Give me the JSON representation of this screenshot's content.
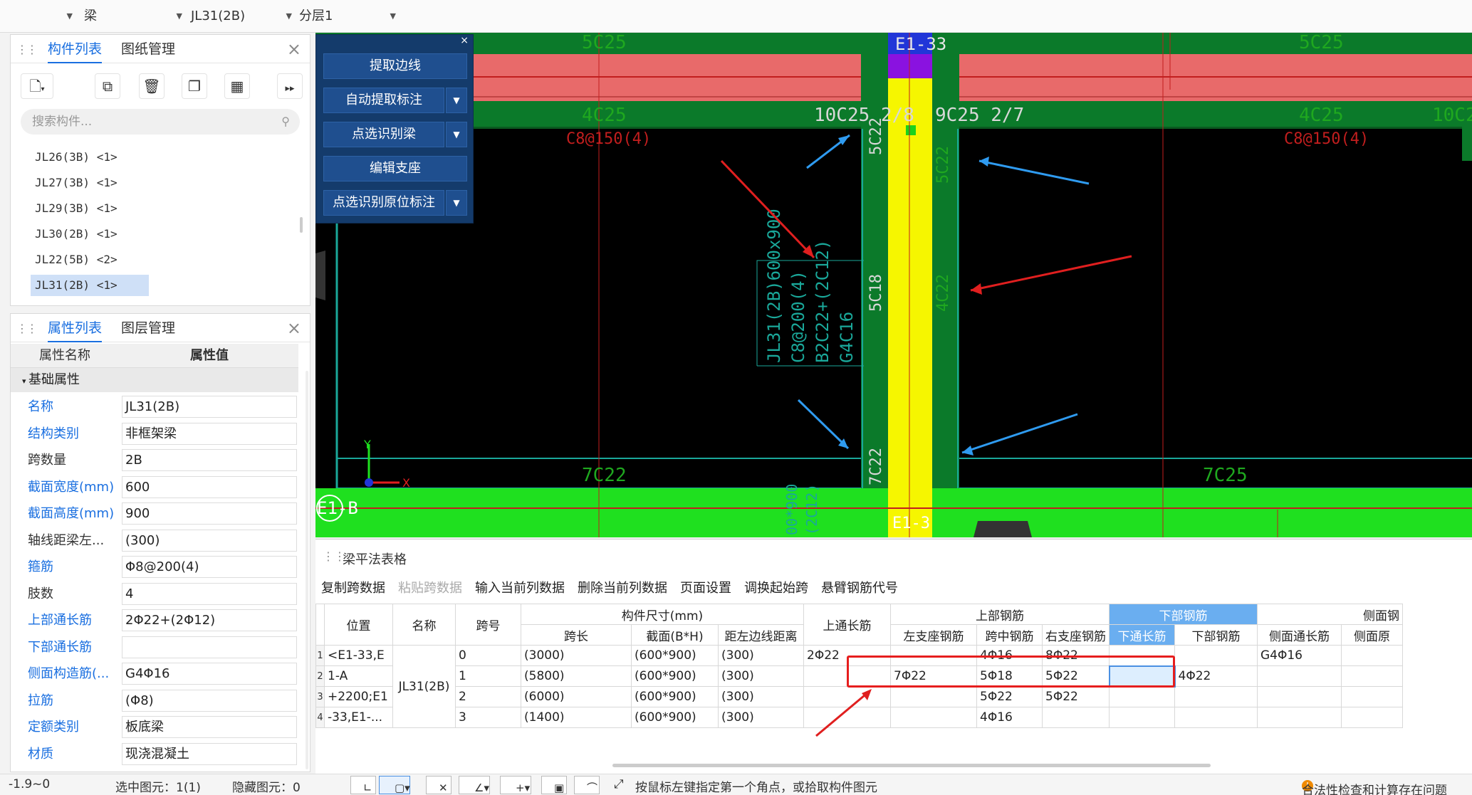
{
  "topbar": {
    "selectors": [
      "",
      "梁",
      "JL31(2B)",
      "分层1"
    ]
  },
  "component_panel": {
    "tabs": [
      "构件列表",
      "图纸管理"
    ],
    "search_placeholder": "搜索构件...",
    "items": [
      "JL26(3B) <1>",
      "JL27(3B) <1>",
      "JL29(3B) <1>",
      "JL30(2B) <1>",
      "JL22(5B) <2>",
      "JL31(2B) <1>"
    ],
    "selected_index": 5
  },
  "property_panel": {
    "tabs": [
      "属性列表",
      "图层管理"
    ],
    "header_name": "属性名称",
    "header_value": "属性值",
    "section": "基础属性",
    "rows": [
      {
        "name": "名称",
        "value": "JL31(2B)"
      },
      {
        "name": "结构类别",
        "value": "非框架梁"
      },
      {
        "name": "跨数量",
        "value": "2B"
      },
      {
        "name": "截面宽度(mm)",
        "value": "600"
      },
      {
        "name": "截面高度(mm)",
        "value": "900"
      },
      {
        "name": "轴线距梁左...",
        "value": "(300)"
      },
      {
        "name": "箍筋",
        "value": "Φ8@200(4)"
      },
      {
        "name": "肢数",
        "value": "4"
      },
      {
        "name": "上部通长筋",
        "value": "2Φ22+(2Φ12)"
      },
      {
        "name": "下部通长筋",
        "value": ""
      },
      {
        "name": "侧面构造筋(...",
        "value": "G4Φ16"
      },
      {
        "name": "拉筋",
        "value": "(Φ8)"
      },
      {
        "name": "定额类别",
        "value": "板底梁"
      },
      {
        "name": "材质",
        "value": "现浇混凝土"
      }
    ]
  },
  "palette": {
    "buttons": [
      "提取边线",
      "自动提取标注",
      "点选识别梁",
      "编辑支座",
      "点选识别原位标注"
    ]
  },
  "canvas": {
    "labels": {
      "top_left_5c25": "5C25",
      "top_right_5c25": "5C25",
      "axis_top": "E1-33",
      "left_4c25": "4C25",
      "left_stirrup": "C8@150(4)",
      "mid_10c25": "10C25 2/8",
      "mid_9c25": "9C25 2/7",
      "right_4c25": "4C25",
      "right_stirrup": "C8@150(4)",
      "far_right_10c25": "10C25",
      "v_5c22_top": "5C22",
      "v_5c22_right": "5C22",
      "v_5c18": "5C18",
      "v_4c22": "4C22",
      "v_7c22_mid": "7C22",
      "beam_note_1": "JL31(2B)600x900",
      "beam_note_2": "C8@200(4)",
      "beam_note_3": "B2C22+(2C12)",
      "beam_note_4": "G4C16",
      "bottom_7c22": "7C22",
      "bottom_7c25": "7C25",
      "axis_left": "E1-B",
      "axis_bottom": "E1-3",
      "v_bottom_1": "00*900",
      "v_bottom_2": "(2C12)",
      "ucs_y": "Y",
      "ucs_x": "X"
    }
  },
  "table_panel": {
    "title": "梁平法表格",
    "toolbar": [
      "复制跨数据",
      "粘贴跨数据",
      "输入当前列数据",
      "删除当前列数据",
      "页面设置",
      "调换起始跨",
      "悬臂钢筋代号"
    ],
    "toolbar_disabled": [
      false,
      true,
      false,
      false,
      false,
      false,
      false
    ],
    "headers_top": {
      "position": "位置",
      "name": "名称",
      "span_no": "跨号",
      "size_group": "构件尺寸(mm)",
      "top_long": "上通长筋",
      "top_group": "上部钢筋",
      "bottom_group": "下部钢筋",
      "side_group": "侧面钢"
    },
    "headers_sub": {
      "span_len": "跨长",
      "section": "截面(B*H)",
      "offset": "距左边线距离",
      "left_support": "左支座钢筋",
      "mid": "跨中钢筋",
      "right_support": "右支座钢筋",
      "bottom_long": "下通长筋",
      "bottom_bars": "下部钢筋",
      "side_long": "侧面通长筋",
      "side_other": "侧面原"
    },
    "row_numbers": [
      "1",
      "2",
      "3",
      "4"
    ],
    "position_lines": [
      "<E1-33,E",
      "1-A",
      "+2200;E1",
      "-33,E1-..."
    ],
    "beam_name": "JL31(2B)",
    "rows": [
      {
        "span": "0",
        "len": "(3000)",
        "section": "(600*900)",
        "offset": "(300)",
        "top_long": "2Φ22",
        "left": "",
        "mid": "4Φ16",
        "right": "8Φ22",
        "bot_long": "",
        "bot": "",
        "side_long": "G4Φ16"
      },
      {
        "span": "1",
        "len": "(5800)",
        "section": "(600*900)",
        "offset": "(300)",
        "top_long": "",
        "left": "7Φ22",
        "mid": "5Φ18",
        "right": "5Φ22",
        "bot_long": "",
        "bot": "4Φ22",
        "side_long": ""
      },
      {
        "span": "2",
        "len": "(6000)",
        "section": "(600*900)",
        "offset": "(300)",
        "top_long": "",
        "left": "",
        "mid": "5Φ22",
        "right": "5Φ22",
        "bot_long": "",
        "bot": "",
        "side_long": ""
      },
      {
        "span": "3",
        "len": "(1400)",
        "section": "(600*900)",
        "offset": "(300)",
        "top_long": "",
        "left": "",
        "mid": "4Φ16",
        "right": "",
        "bot_long": "",
        "bot": "",
        "side_long": ""
      }
    ]
  },
  "status": {
    "coord": "-1.9~0",
    "selected": "选中图元：1(1)",
    "hidden": "隐藏图元：0",
    "hint": "按鼠标左键指定第一个角点，或拾取构件图元",
    "check": "合法性检查和计算存在问题"
  }
}
